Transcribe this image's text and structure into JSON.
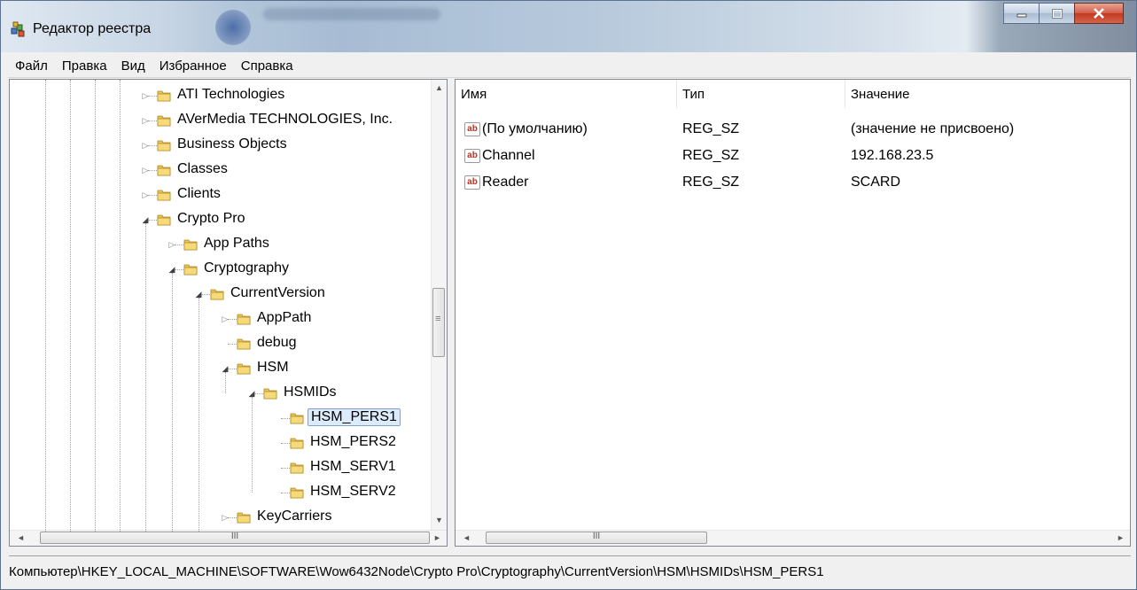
{
  "window": {
    "title": "Редактор реестра"
  },
  "menu": [
    "Файл",
    "Правка",
    "Вид",
    "Избранное",
    "Справка"
  ],
  "tree": [
    {
      "label": "ATI Technologies",
      "level": 0,
      "expander": "closed"
    },
    {
      "label": "AVerMedia TECHNOLOGIES, Inc.",
      "level": 0,
      "expander": "closed"
    },
    {
      "label": "Business Objects",
      "level": 0,
      "expander": "closed"
    },
    {
      "label": "Classes",
      "level": 0,
      "expander": "closed"
    },
    {
      "label": "Clients",
      "level": 0,
      "expander": "closed"
    },
    {
      "label": "Crypto Pro",
      "level": 0,
      "expander": "open"
    },
    {
      "label": "App Paths",
      "level": 1,
      "expander": "closed"
    },
    {
      "label": "Cryptography",
      "level": 1,
      "expander": "open"
    },
    {
      "label": "CurrentVersion",
      "level": 2,
      "expander": "open"
    },
    {
      "label": "AppPath",
      "level": 3,
      "expander": "closed"
    },
    {
      "label": "debug",
      "level": 3,
      "expander": "none"
    },
    {
      "label": "HSM",
      "level": 3,
      "expander": "open"
    },
    {
      "label": "HSMIDs",
      "level": 4,
      "expander": "open"
    },
    {
      "label": "HSM_PERS1",
      "level": 5,
      "expander": "none",
      "selected": true
    },
    {
      "label": "HSM_PERS2",
      "level": 5,
      "expander": "none"
    },
    {
      "label": "HSM_SERV1",
      "level": 5,
      "expander": "none"
    },
    {
      "label": "HSM_SERV2",
      "level": 5,
      "expander": "none"
    },
    {
      "label": "KeyCarriers",
      "level": 3,
      "expander": "closed"
    }
  ],
  "list": {
    "columns": [
      "Имя",
      "Тип",
      "Значение"
    ],
    "rows": [
      {
        "name": "(По умолчанию)",
        "type": "REG_SZ",
        "value": "(значение не присвоено)"
      },
      {
        "name": "Channel",
        "type": "REG_SZ",
        "value": "192.168.23.5"
      },
      {
        "name": "Reader",
        "type": "REG_SZ",
        "value": "SCARD"
      }
    ],
    "value_icon_text": "ab"
  },
  "scroll": {
    "hthumb_text": "III",
    "vthumb_text": "≡"
  },
  "status": {
    "path": "Компьютер\\HKEY_LOCAL_MACHINE\\SOFTWARE\\Wow6432Node\\Crypto Pro\\Cryptography\\CurrentVersion\\HSM\\HSMIDs\\HSM_PERS1"
  }
}
